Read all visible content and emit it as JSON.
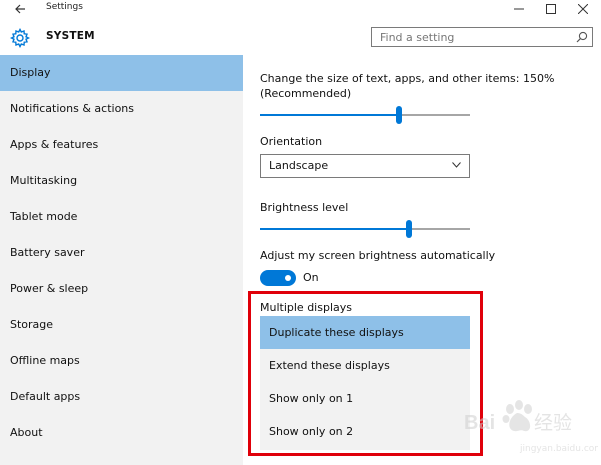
{
  "window": {
    "title": "Settings",
    "back_icon": "back-arrow-icon",
    "controls": [
      "minimize-icon",
      "maximize-icon",
      "close-icon"
    ]
  },
  "header": {
    "title": "SYSTEM",
    "icon": "gear-icon",
    "search_placeholder": "Find a setting"
  },
  "sidebar": {
    "items": [
      {
        "label": "Display",
        "selected": true
      },
      {
        "label": "Notifications & actions"
      },
      {
        "label": "Apps & features"
      },
      {
        "label": "Multitasking"
      },
      {
        "label": "Tablet mode"
      },
      {
        "label": "Battery saver"
      },
      {
        "label": "Power & sleep"
      },
      {
        "label": "Storage"
      },
      {
        "label": "Offline maps"
      },
      {
        "label": "Default apps"
      },
      {
        "label": "About"
      }
    ]
  },
  "main": {
    "scale_label_line1": "Change the size of text, apps, and other items: 150%",
    "scale_label_line2": "(Recommended)",
    "scale_slider_value": 0.66,
    "orientation_label": "Orientation",
    "orientation_value": "Landscape",
    "brightness_label": "Brightness level",
    "brightness_slider_value": 0.71,
    "auto_brightness_label": "Adjust my screen brightness automatically",
    "auto_brightness_state": "On",
    "multiple_displays_label": "Multiple displays",
    "multiple_displays_options": [
      {
        "label": "Duplicate these displays",
        "selected": true
      },
      {
        "label": "Extend these displays"
      },
      {
        "label": "Show only on 1"
      },
      {
        "label": "Show only on 2"
      }
    ]
  },
  "watermark": {
    "text": "Baidu 经验",
    "url_text": "jingyan.baidu.com"
  },
  "colors": {
    "accent": "#0078d7",
    "selection": "#8ec0e8",
    "sidebar_bg": "#f2f2f2",
    "highlight_box": "#e0000a"
  }
}
